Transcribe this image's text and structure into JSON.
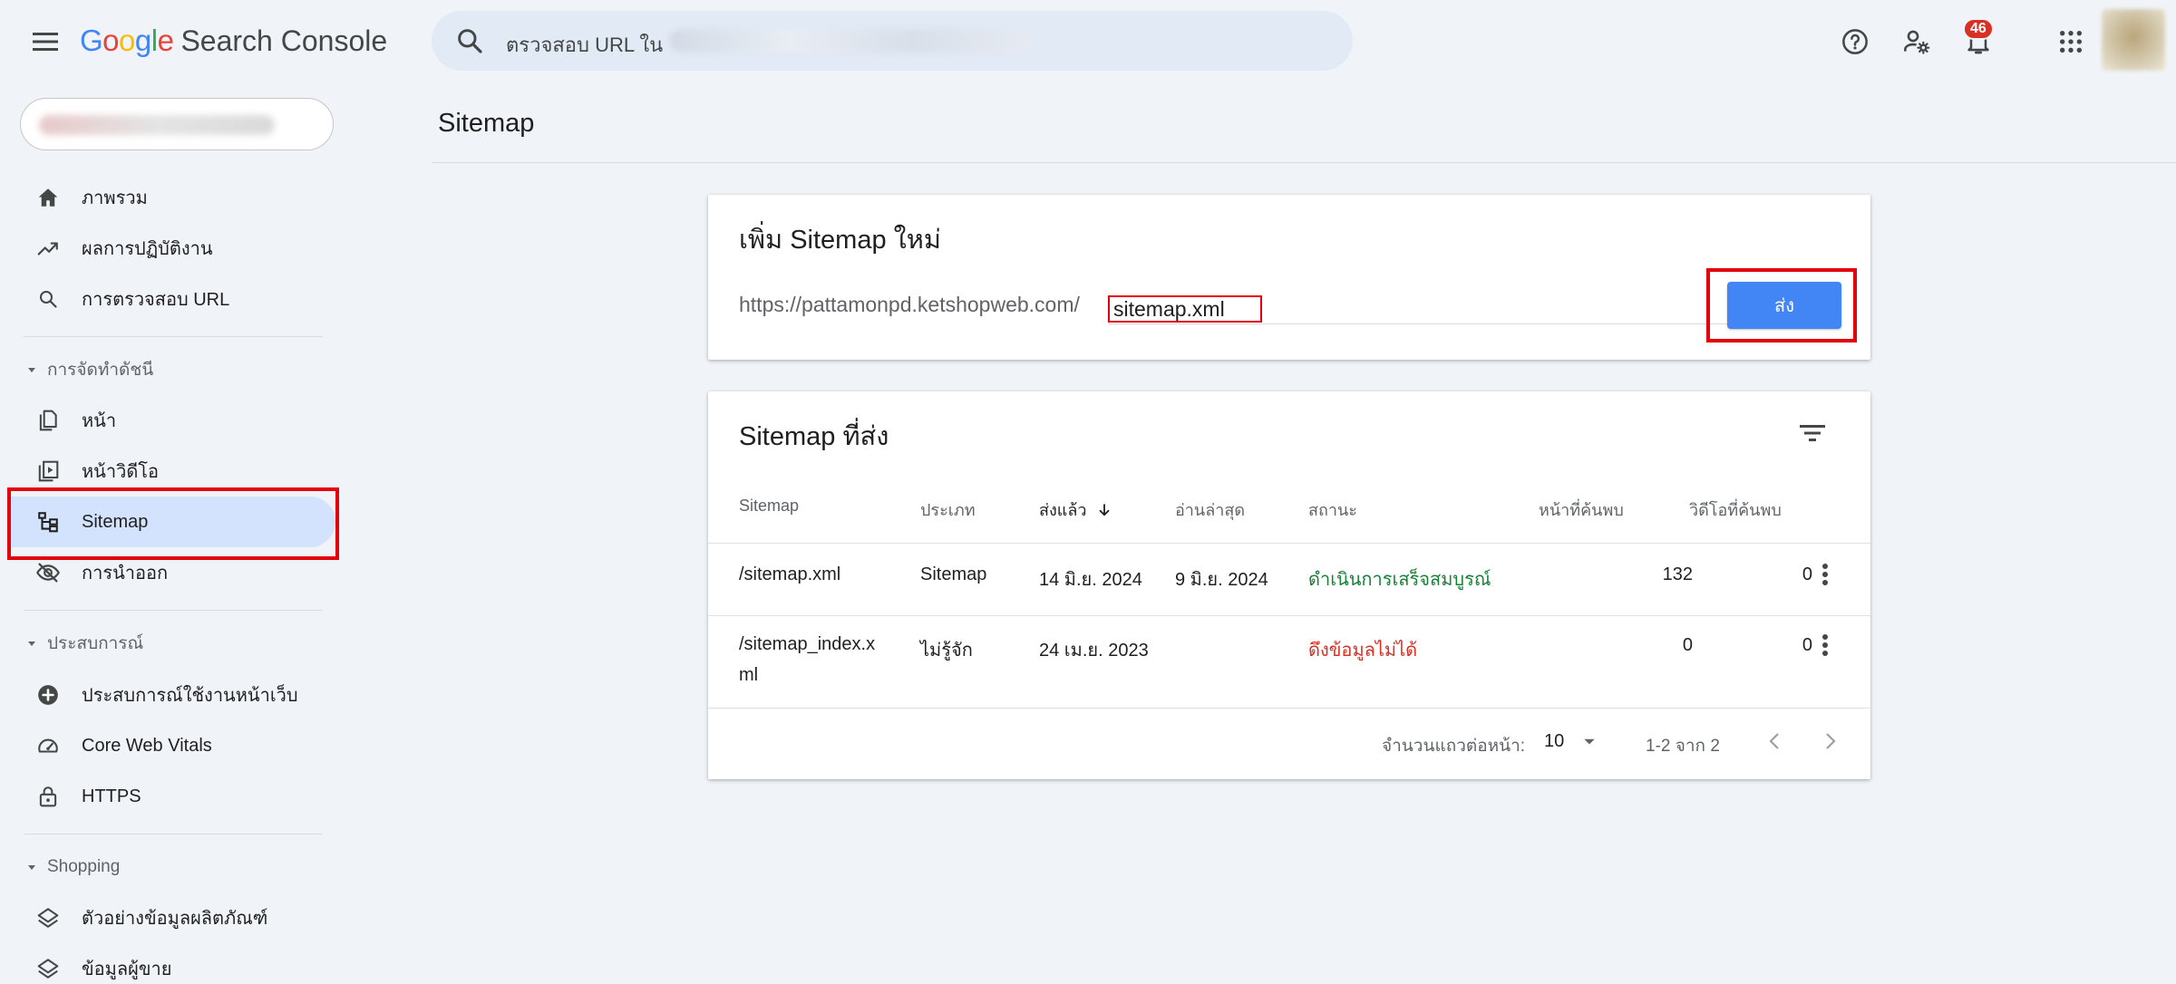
{
  "app": {
    "logo_letters": [
      "G",
      "o",
      "o",
      "g",
      "l",
      "e"
    ],
    "logo_colors": [
      "#4285f4",
      "#ea4335",
      "#fbbc05",
      "#4285f4",
      "#34a853",
      "#ea4335"
    ],
    "product": "Search Console"
  },
  "search": {
    "placeholder": "ตรวจสอบ URL ใน"
  },
  "header": {
    "notification_count": "46"
  },
  "sidebar": {
    "items_top": [
      {
        "label": "ภาพรวม",
        "icon": "home-icon"
      },
      {
        "label": "ผลการปฏิบัติงาน",
        "icon": "trending-up-icon"
      },
      {
        "label": "การตรวจสอบ URL",
        "icon": "search-icon"
      }
    ],
    "section_indexing": "การจัดทำดัชนี",
    "items_indexing": [
      {
        "label": "หน้า",
        "icon": "pages-icon"
      },
      {
        "label": "หน้าวิดีโอ",
        "icon": "video-pages-icon"
      },
      {
        "label": "Sitemap",
        "icon": "sitemap-icon"
      },
      {
        "label": "การนำออก",
        "icon": "removals-icon"
      }
    ],
    "section_experience": "ประสบการณ์",
    "items_experience": [
      {
        "label": "ประสบการณ์ใช้งานหน้าเว็บ",
        "icon": "page-experience-icon"
      },
      {
        "label": "Core Web Vitals",
        "icon": "speed-gauge-icon"
      },
      {
        "label": "HTTPS",
        "icon": "lock-icon"
      }
    ],
    "section_shopping": "Shopping",
    "items_shopping": [
      {
        "label": "ตัวอย่างข้อมูลผลิตภัณฑ์",
        "icon": "layers-icon"
      },
      {
        "label": "ข้อมูลผู้ขาย",
        "icon": "layers-icon"
      }
    ]
  },
  "main": {
    "page_title": "Sitemap",
    "add_card": {
      "title": "เพิ่ม Sitemap ใหม่",
      "url_prefix": "https://pattamonpd.ketshopweb.com/",
      "input_value": "sitemap.xml",
      "submit_label": "ส่ง"
    },
    "submitted_card": {
      "title": "Sitemap ที่ส่ง",
      "columns": [
        "Sitemap",
        "ประเภท",
        "ส่งแล้ว",
        "อ่านล่าสุด",
        "สถานะ",
        "หน้าที่ค้นพบ",
        "วิดีโอที่ค้นพบ"
      ],
      "rows": [
        {
          "sitemap": "/sitemap.xml",
          "type": "Sitemap",
          "submitted": "14 มิ.ย. 2024",
          "last_read": "9 มิ.ย. 2024",
          "status": "ดำเนินการเสร็จสมบูรณ์",
          "status_color": "#188038",
          "pages": "132",
          "videos": "0"
        },
        {
          "sitemap": "/sitemap_index.xml",
          "type": "ไม่รู้จัก",
          "submitted": "24 เม.ย. 2023",
          "last_read": "",
          "status": "ดึงข้อมูลไม่ได้",
          "status_color": "#d93025",
          "pages": "0",
          "videos": "0"
        }
      ],
      "pagination": {
        "rows_per_page_label": "จำนวนแถวต่อหน้า:",
        "rows_per_page": "10",
        "range": "1-2 จาก 2"
      }
    }
  }
}
